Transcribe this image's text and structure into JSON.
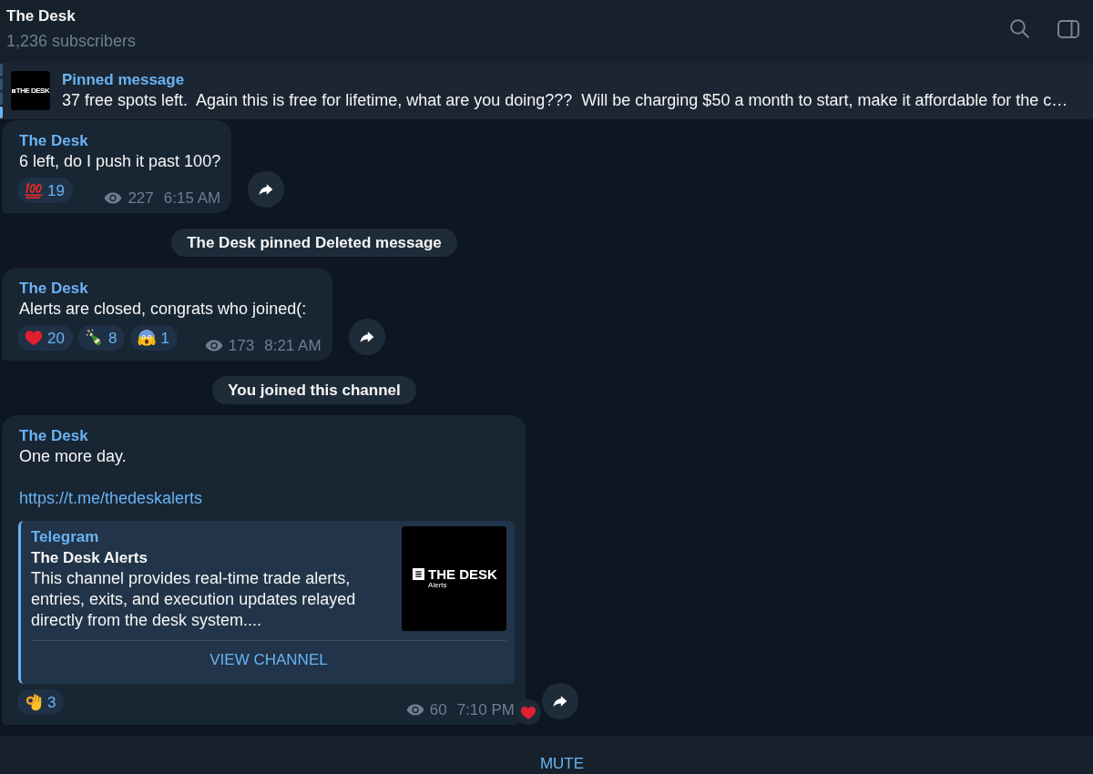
{
  "header": {
    "title": "The Desk",
    "subtitle": "1,236 subscribers"
  },
  "pinned": {
    "label": "Pinned message",
    "text": "37 free spots left.  Again this is free for lifetime, what are you doing???  Will be charging $50 a month to start, make it affordable for the c…",
    "thumbnail_logo": "THE DESK"
  },
  "messages": [
    {
      "kind": "post",
      "author": "The Desk",
      "text": "6 left, do I push it past 100?",
      "reactions": [
        {
          "kind": "hundred",
          "count": "19"
        }
      ],
      "views": "227",
      "time": "6:15 AM"
    },
    {
      "kind": "service",
      "text": "The Desk pinned Deleted message"
    },
    {
      "kind": "post",
      "author": "The Desk",
      "text": "Alerts are closed, congrats who joined(:",
      "reactions": [
        {
          "kind": "heart",
          "count": "20"
        },
        {
          "kind": "champagne",
          "count": "8"
        },
        {
          "kind": "scream",
          "count": "1"
        }
      ],
      "views": "173",
      "time": "8:21 AM"
    },
    {
      "kind": "service",
      "text": "You joined this channel"
    },
    {
      "kind": "post",
      "author": "The Desk",
      "text": "One more day.",
      "link": "https://t.me/thedeskalerts",
      "link_preview": {
        "site": "Telegram",
        "title": "The Desk Alerts",
        "description": "This channel provides real-time trade alerts, entries, exits, and execution updates relayed directly from the desk system....",
        "logo_title": "THE DESK",
        "logo_subtitle": "Alerts",
        "button": "VIEW CHANNEL"
      },
      "reactions": [
        {
          "kind": "ok_hand",
          "count": "3"
        }
      ],
      "views": "60",
      "time": "7:10 PM",
      "reaction_badge": {
        "kind": "heart"
      }
    }
  ],
  "footer": {
    "button": "MUTE"
  }
}
